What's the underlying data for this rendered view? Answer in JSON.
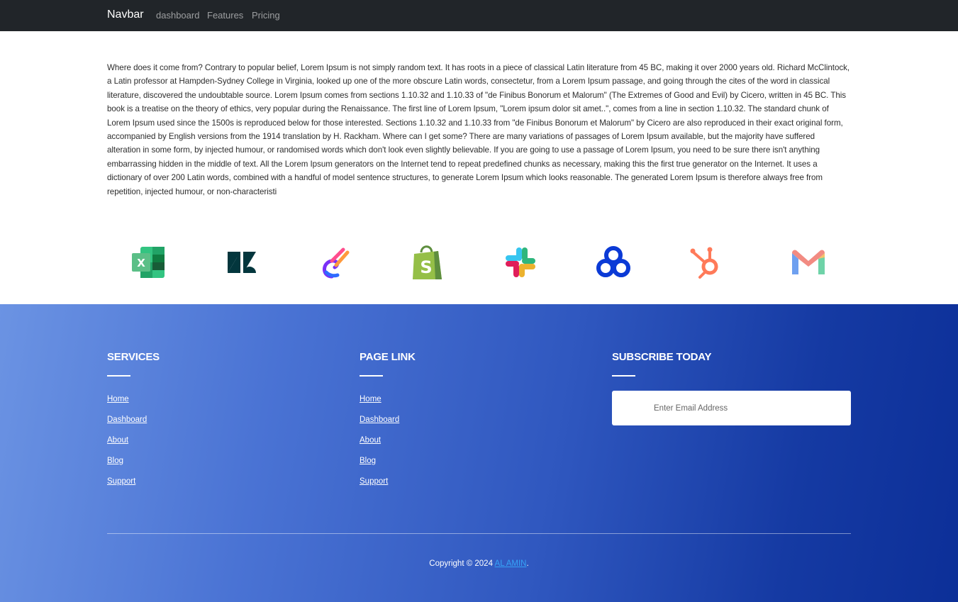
{
  "navbar": {
    "brand": "Navbar",
    "links": [
      "dashboard",
      "Features",
      "Pricing"
    ]
  },
  "content": {
    "paragraph": "Where does it come from? Contrary to popular belief, Lorem Ipsum is not simply random text. It has roots in a piece of classical Latin literature from 45 BC, making it over 2000 years old. Richard McClintock, a Latin professor at Hampden-Sydney College in Virginia, looked up one of the more obscure Latin words, consectetur, from a Lorem Ipsum passage, and going through the cites of the word in classical literature, discovered the undoubtable source. Lorem Ipsum comes from sections 1.10.32 and 1.10.33 of \"de Finibus Bonorum et Malorum\" (The Extremes of Good and Evil) by Cicero, written in 45 BC. This book is a treatise on the theory of ethics, very popular during the Renaissance. The first line of Lorem Ipsum, \"Lorem ipsum dolor sit amet..\", comes from a line in section 1.10.32. The standard chunk of Lorem Ipsum used since the 1500s is reproduced below for those interested. Sections 1.10.32 and 1.10.33 from \"de Finibus Bonorum et Malorum\" by Cicero are also reproduced in their exact original form, accompanied by English versions from the 1914 translation by H. Rackham. Where can I get some? There are many variations of passages of Lorem Ipsum available, but the majority have suffered alteration in some form, by injected humour, or randomised words which don't look even slightly believable. If you are going to use a passage of Lorem Ipsum, you need to be sure there isn't anything embarrassing hidden in the middle of text. All the Lorem Ipsum generators on the Internet tend to repeat predefined chunks as necessary, making this the first true generator on the Internet. It uses a dictionary of over 200 Latin words, combined with a handful of model sentence structures, to generate Lorem Ipsum which looks reasonable. The generated Lorem Ipsum is therefore always free from repetition, injected humour, or non-characteristi"
  },
  "logos": [
    "excel-icon",
    "zendesk-icon",
    "loop-icon",
    "shopify-icon",
    "slack-icon",
    "circles-icon",
    "hubspot-icon",
    "gmail-icon"
  ],
  "footer": {
    "services": {
      "title": "SERVICES",
      "links": [
        "Home",
        "Dashboard",
        "About",
        "Blog",
        "Support"
      ]
    },
    "page_link": {
      "title": "PAGE LINK",
      "links": [
        "Home",
        "Dashboard",
        "About",
        "Blog",
        "Support"
      ]
    },
    "subscribe": {
      "title": "SUBSCRIBE TODAY",
      "placeholder": "Enter Email Address"
    },
    "copyright": {
      "prefix": "Copyright © 2024 ",
      "author": "AL AMIN",
      "suffix": "."
    }
  },
  "colors": {
    "navbar_bg": "#212529",
    "footer_gradient_start": "#6b93e3",
    "footer_gradient_end": "#0c2f98",
    "copyright_link": "#36a3f7"
  }
}
